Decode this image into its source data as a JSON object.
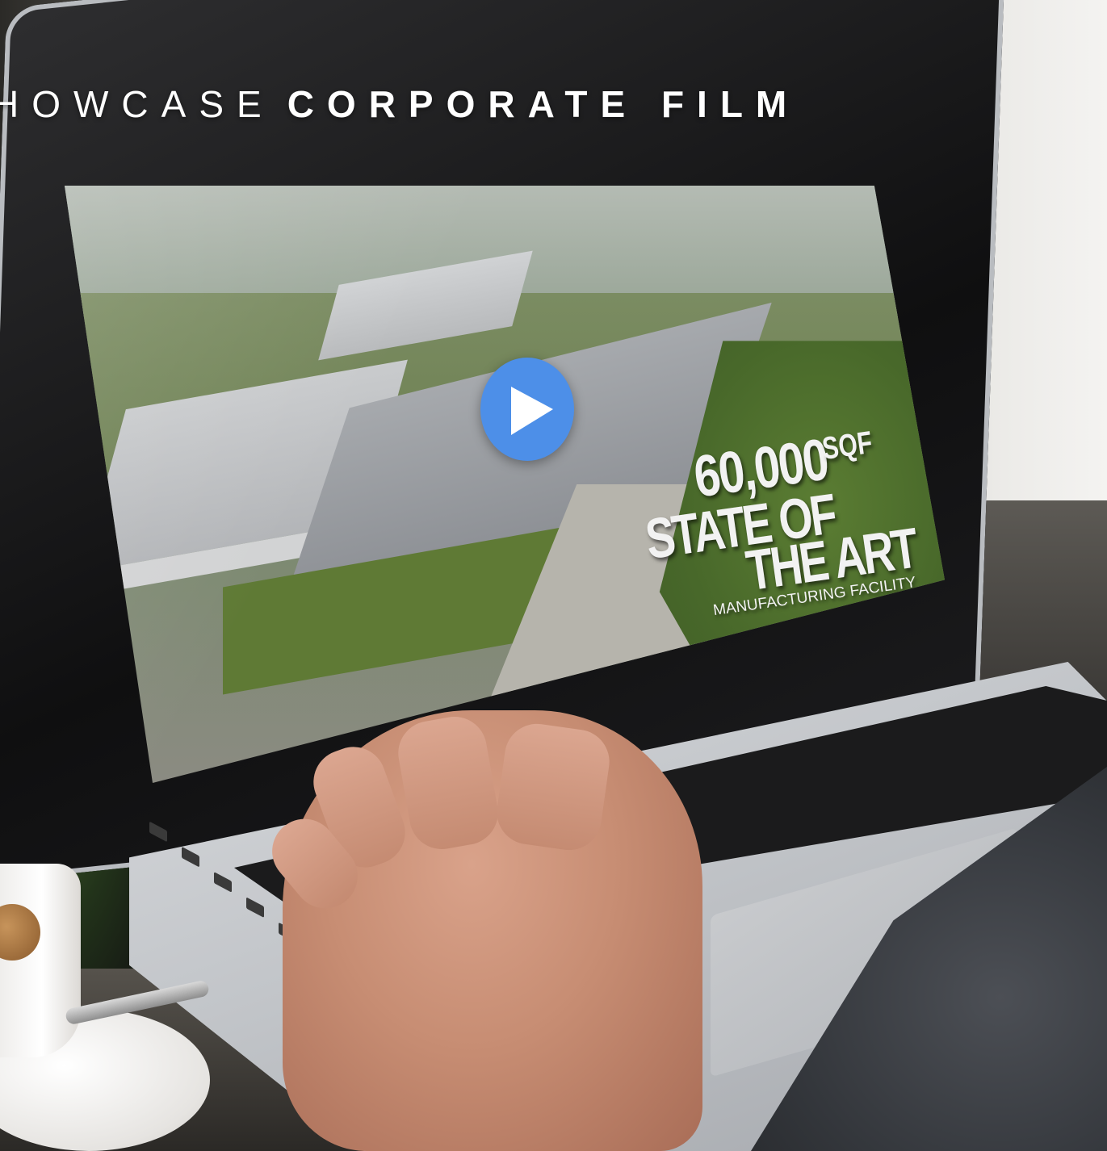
{
  "header": {
    "title_light": "HOWCASE",
    "title_bold": "CORPORATE FILM"
  },
  "video": {
    "play_button_label": "Play",
    "overlay": {
      "number": "60,000",
      "unit": "SQF",
      "line1": "STATE OF",
      "line2": "THE ART",
      "subline": "MANUFACTURING FACILITY"
    }
  },
  "colors": {
    "play_button": "#4d8fe8",
    "title_text": "#ffffff"
  },
  "icons": {
    "play": "play-triangle-icon"
  }
}
